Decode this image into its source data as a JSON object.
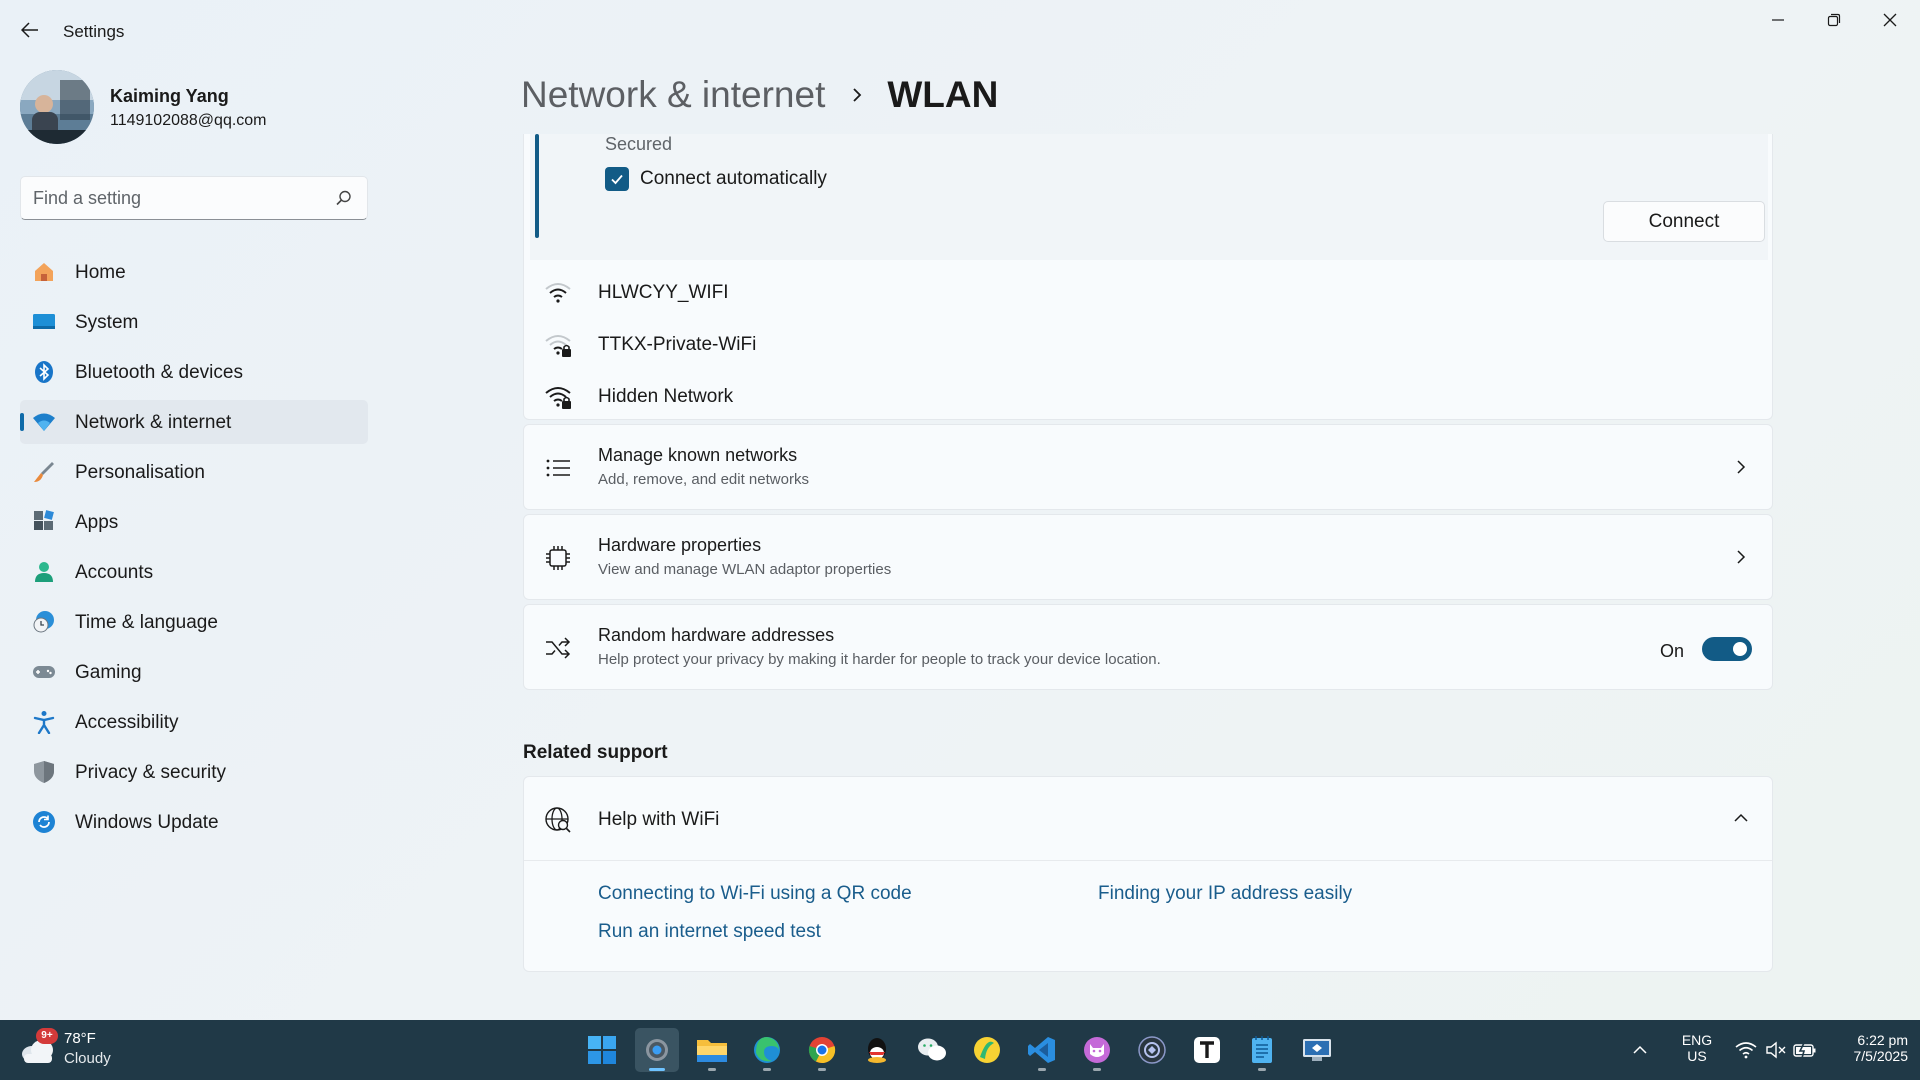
{
  "window": {
    "title": "Settings",
    "minimize_label": "Minimize",
    "restore_label": "Restore",
    "close_label": "Close"
  },
  "profile": {
    "name": "Kaiming Yang",
    "email": "1149102088@qq.com"
  },
  "search": {
    "placeholder": "Find a setting",
    "value": ""
  },
  "sidebar": {
    "items": [
      {
        "label": "Home",
        "icon": "home-icon"
      },
      {
        "label": "System",
        "icon": "system-icon"
      },
      {
        "label": "Bluetooth & devices",
        "icon": "bluetooth-icon"
      },
      {
        "label": "Network & internet",
        "icon": "wifi-icon",
        "active": true
      },
      {
        "label": "Personalisation",
        "icon": "brush-icon"
      },
      {
        "label": "Apps",
        "icon": "apps-icon"
      },
      {
        "label": "Accounts",
        "icon": "person-icon"
      },
      {
        "label": "Time & language",
        "icon": "clock-globe-icon"
      },
      {
        "label": "Gaming",
        "icon": "gamepad-icon"
      },
      {
        "label": "Accessibility",
        "icon": "accessibility-icon"
      },
      {
        "label": "Privacy & security",
        "icon": "shield-icon"
      },
      {
        "label": "Windows Update",
        "icon": "update-icon"
      }
    ]
  },
  "breadcrumb": {
    "parent": "Network & internet",
    "current": "WLAN"
  },
  "network_list": {
    "expanded": {
      "status": "Secured",
      "auto_connect_label": "Connect automatically",
      "auto_connect_checked": true,
      "connect_label": "Connect"
    },
    "networks": [
      {
        "name": "HLWCYY_WIFI",
        "icon": "wifi-weak-icon",
        "secured": false
      },
      {
        "name": "TTKX-Private-WiFi",
        "icon": "wifi-lock-icon",
        "secured": true
      },
      {
        "name": "Hidden Network",
        "icon": "wifi-lock-icon",
        "secured": true
      }
    ]
  },
  "settings_cards": {
    "manage": {
      "title": "Manage known networks",
      "subtitle": "Add, remove, and edit networks",
      "icon": "list-icon"
    },
    "hardware": {
      "title": "Hardware properties",
      "subtitle": "View and manage WLAN adaptor properties",
      "icon": "chip-icon"
    },
    "random": {
      "title": "Random hardware addresses",
      "subtitle": "Help protect your privacy by making it harder for people to track your device location.",
      "icon": "shuffle-icon",
      "toggle_label": "On",
      "toggle_on": true
    }
  },
  "related_support": {
    "title": "Related support",
    "help": {
      "title": "Help with WiFi",
      "icon": "globe-search-icon",
      "expanded": true,
      "links": [
        "Connecting to Wi-Fi using a QR code",
        "Finding your IP address easily",
        "Run an internet speed test"
      ]
    }
  },
  "taskbar": {
    "weather": {
      "temp": "78°F",
      "condition": "Cloudy",
      "badge": "9+"
    },
    "apps": [
      "windows-start-icon",
      "settings-icon",
      "file-explorer-icon",
      "edge-icon",
      "chrome-icon",
      "qq-icon",
      "wechat-icon",
      "yellow-app-icon",
      "vscode-icon",
      "cat-app-icon",
      "circle-app-icon",
      "typora-icon",
      "notepad-icon",
      "remote-desktop-icon"
    ],
    "language": {
      "line1": "ENG",
      "line2": "US"
    },
    "time": "6:22 pm",
    "date": "7/5/2025"
  },
  "colors": {
    "accent": "#125b86",
    "link": "#1a5d8c",
    "taskbar": "#203947"
  }
}
